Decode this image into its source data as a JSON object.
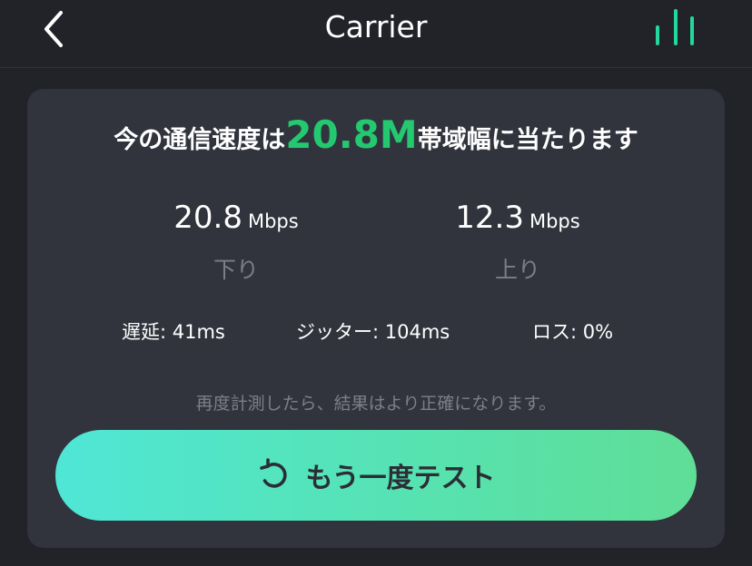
{
  "nav": {
    "title": "Carrier",
    "back_icon": "chevron-left-icon",
    "signal_icon": "signal-bars-icon"
  },
  "headline": {
    "prefix": "今の通信速度は",
    "speed": "20.8M",
    "suffix": "帯域幅に当たります"
  },
  "download": {
    "value": "20.8",
    "unit": "Mbps",
    "label": "下り"
  },
  "upload": {
    "value": "12.3",
    "unit": "Mbps",
    "label": "上り"
  },
  "stats": {
    "latency": "遅延: 41ms",
    "jitter": "ジッター: 104ms",
    "loss": "ロス: 0%"
  },
  "hint": "再度計測したら、結果はより正確になります。",
  "retest": {
    "label": "もう一度テスト",
    "icon": "refresh-icon"
  },
  "colors": {
    "background": "#212329",
    "card": "#31343d",
    "accent_green": "#23c870",
    "muted_text": "#7c7f87",
    "button_gradient_start": "#4fe6d6",
    "button_gradient_end": "#5fde96"
  }
}
